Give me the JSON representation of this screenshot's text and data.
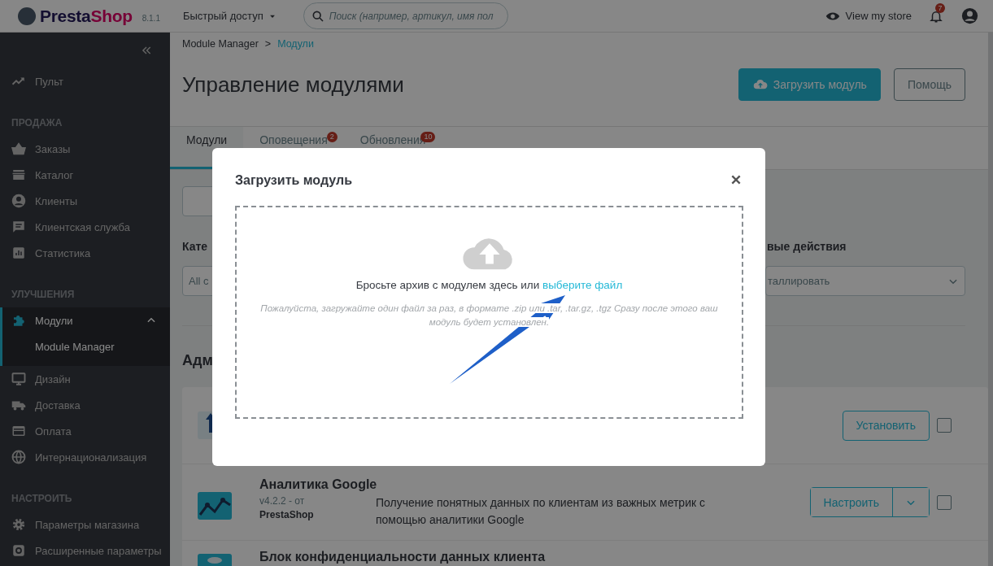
{
  "header": {
    "brand_parts": [
      "Presta",
      "Shop"
    ],
    "version": "8.1.1",
    "quick_access": "Быстрый доступ",
    "search": {
      "placeholder": "Поиск (например, артикул, имя пол"
    },
    "view_store": "View my store",
    "notifications_badge": "7"
  },
  "sidebar": {
    "items": [
      {
        "kind": "item",
        "label": "Пульт",
        "selected": false
      },
      {
        "kind": "section",
        "label": "ПРОДАЖА"
      },
      {
        "kind": "item",
        "label": "Заказы",
        "selected": false
      },
      {
        "kind": "item",
        "label": "Каталог",
        "selected": false
      },
      {
        "kind": "item",
        "label": "Клиенты",
        "selected": false
      },
      {
        "kind": "item",
        "label": "Клиентская служба",
        "selected": false
      },
      {
        "kind": "item",
        "label": "Статистика",
        "selected": false
      },
      {
        "kind": "section",
        "label": "УЛУЧШЕНИЯ"
      },
      {
        "kind": "item",
        "label": "Модули",
        "selected": true,
        "expanded": true,
        "children": [
          {
            "label": "Module Manager",
            "selected": true
          }
        ]
      },
      {
        "kind": "item",
        "label": "Дизайн",
        "selected": false
      },
      {
        "kind": "item",
        "label": "Доставка",
        "selected": false
      },
      {
        "kind": "item",
        "label": "Оплата",
        "selected": false
      },
      {
        "kind": "item",
        "label": "Интернационализация",
        "selected": false
      },
      {
        "kind": "section",
        "label": "НАСТРОИТЬ"
      },
      {
        "kind": "item",
        "label": "Параметры магазина",
        "selected": false
      },
      {
        "kind": "item",
        "label": "Расширенные параметры",
        "selected": false
      }
    ]
  },
  "breadcrumb": {
    "items": [
      "Module Manager",
      "Модули"
    ],
    "separator": ">"
  },
  "page_title": "Управление модулями",
  "toolbar_buttons": [
    {
      "kind": "primary",
      "label": "Загрузить модуль"
    },
    {
      "kind": "secondary",
      "label": "Помощь"
    }
  ],
  "tabs": [
    {
      "label": "Модули",
      "selected": true
    },
    {
      "label": "Оповещения",
      "selected": false,
      "badge": "2"
    },
    {
      "label": "Обновления",
      "selected": false,
      "badge": "10"
    }
  ],
  "filters": {
    "category_label": "Кате",
    "category_value": "All c",
    "bulk_label": "вые действия",
    "bulk_value": "таллировать"
  },
  "section_title": "Адм",
  "modules": [
    {
      "kind": "single",
      "action": "Установить",
      "checked": false
    },
    {
      "kind": "split",
      "name": "Аналитика Google",
      "version": "v4.2.2 - от",
      "author": "PrestaShop",
      "description": "Получение понятных данных по клиентам из важных метрик с помощью аналитики Google",
      "action": "Настроить",
      "checked": false
    },
    {
      "kind": "title_only",
      "name": "Блок конфиденциальности данных клиента"
    }
  ],
  "modal": {
    "title": "Загрузить модуль",
    "drop_text": "Бросьте архив с модулем здесь или",
    "link": "выберите файл",
    "hint": "Пожалуйста, загружайте один файл за раз, в формате .zip или .tar, .tar.gz, .tgz Сразу после этого ваш модуль будет установлен."
  }
}
